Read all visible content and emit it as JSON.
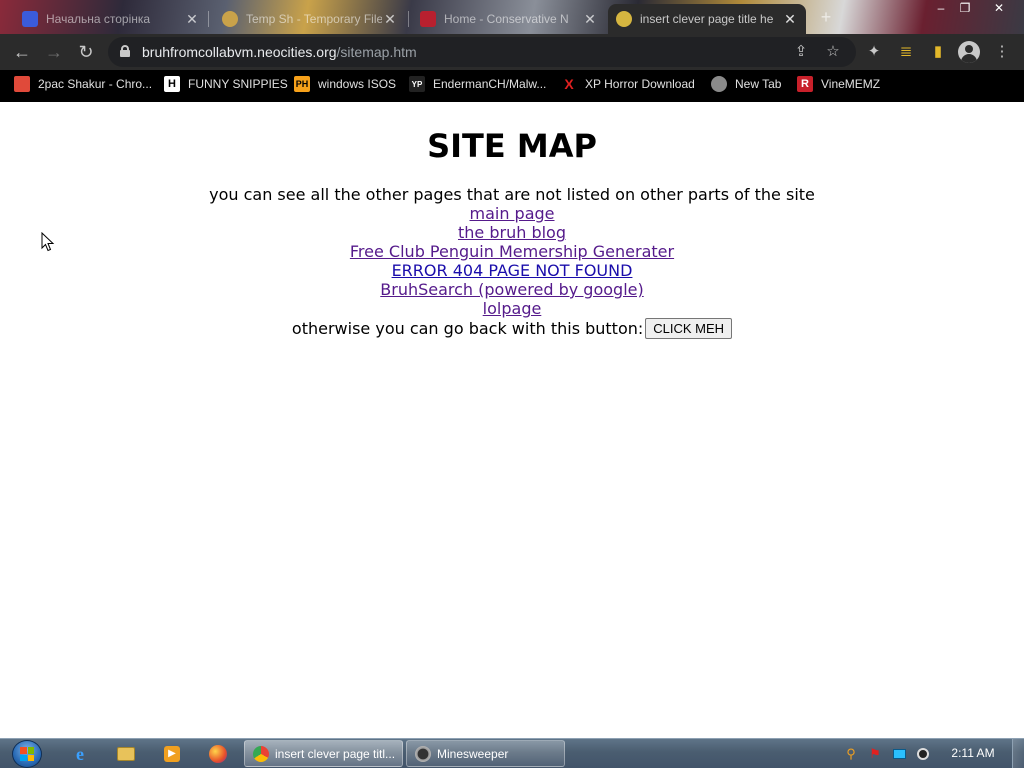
{
  "browser": {
    "tabs": [
      {
        "title": "Начальна сторінка",
        "active": false
      },
      {
        "title": "Temp Sh - Temporary File",
        "active": false
      },
      {
        "title": "Home - Conservative N",
        "active": false
      },
      {
        "title": "insert clever page title he",
        "active": true
      }
    ],
    "new_tab_glyph": "+",
    "window_controls": {
      "minimize": "–",
      "maximize": "❐",
      "close": "✕"
    },
    "url": {
      "domain": "bruhfromcollabvm.neocities.org",
      "path": "/sitemap.htm"
    },
    "bookmarks": [
      {
        "label": "2pac Shakur - Chro...",
        "icon": "bag-icon"
      },
      {
        "label": "FUNNY SNIPPIES",
        "icon": "h-icon",
        "icon_text": "H"
      },
      {
        "label": "windows ISOS",
        "icon": "ph-icon",
        "icon_text": "PH"
      },
      {
        "label": "EndermanCH/Malw...",
        "icon": "yp-icon",
        "icon_text": "YP"
      },
      {
        "label": "XP Horror Download",
        "icon": "x-icon",
        "icon_text": "X"
      },
      {
        "label": "New Tab",
        "icon": "globe-icon"
      },
      {
        "label": "VineMEMZ",
        "icon": "r-icon",
        "icon_text": "R"
      }
    ]
  },
  "page": {
    "heading": "SITE MAP",
    "intro": "you can see all the other pages that are not listed on other parts of the site",
    "links": [
      "main page",
      "the bruh blog",
      "Free Club Penguin Memership Generater",
      "ERROR 404 PAGE NOT FOUND",
      "BruhSearch (powered by google)",
      "lolpage"
    ],
    "back_text": "otherwise you can go back with this button:",
    "back_button": "CLICK MEH"
  },
  "taskbar": {
    "tasks": [
      {
        "label": "insert clever page titl...",
        "active": true
      },
      {
        "label": "Minesweeper",
        "active": false
      }
    ],
    "clock": "2:11 AM"
  },
  "colors": {
    "toolbar": "#2b2b2b",
    "bookmarks_bar": "#000000",
    "link_visited": "#551a8b",
    "link": "#0000ee"
  }
}
